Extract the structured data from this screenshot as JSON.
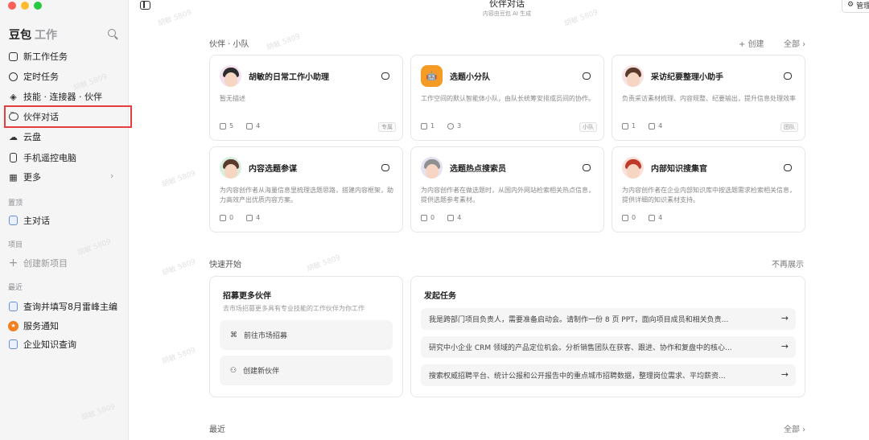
{
  "window": {
    "title": "伙伴对话",
    "subtitle": "内容由豆包 AI 生成",
    "manage_label": "管理"
  },
  "sidebar": {
    "brand": "豆包",
    "brand_sub": "工作",
    "items": [
      {
        "label": "新工作任务",
        "icon": "edit-icon"
      },
      {
        "label": "定时任务",
        "icon": "clock-icon"
      },
      {
        "label": "技能 · 连接器 · 伙伴",
        "icon": "layers-icon"
      },
      {
        "label": "伙伴对话",
        "icon": "chat-bubble-icon"
      },
      {
        "label": "云盘",
        "icon": "cloud-icon"
      },
      {
        "label": "手机遥控电脑",
        "icon": "phone-icon"
      },
      {
        "label": "更多",
        "icon": "grid-icon"
      }
    ],
    "pinned_label": "置顶",
    "pinned": [
      {
        "label": "主对话"
      }
    ],
    "projects_label": "项目",
    "create_project": "创建新项目",
    "recent_label": "最近",
    "recent": [
      {
        "label": "查询并填写8月雷峰主编"
      },
      {
        "label": "服务通知"
      },
      {
        "label": "企业知识查询"
      }
    ]
  },
  "main": {
    "partners_title": "伙伴 · 小队",
    "create_label": "+ 创建",
    "all_label": "全部 ›",
    "cards": [
      {
        "name": "胡敏的日常工作小助理",
        "desc": "暂无描述",
        "stat1": "5",
        "stat2": "4",
        "tag": "专属"
      },
      {
        "name": "选题小分队",
        "desc": "工作空间的默认智能体小队，由队长统筹安排成员间的协作。",
        "stat1": "1",
        "stat2": "3",
        "tag": "小队"
      },
      {
        "name": "采访纪要整理小助手",
        "desc": "负责采访素材梳理、内容规整、纪要输出，提升信息处理效率",
        "stat1": "1",
        "stat2": "4",
        "tag": "团队"
      },
      {
        "name": "内容选题参谋",
        "desc": "为内容创作者从海量信息里梳理选题思路，搭建内容框架，助力高效产出优质内容方案。",
        "stat1": "0",
        "stat2": "4",
        "tag": ""
      },
      {
        "name": "选题热点搜索员",
        "desc": "为内容创作者在做选题时，从国内外网站检索相关热点信息，提供选题参考素材。",
        "stat1": "0",
        "stat2": "4",
        "tag": ""
      },
      {
        "name": "内部知识搜集官",
        "desc": "为内容创作者在企业内部知识库中按选题需求检索相关信息，提供详细的知识素材支持。",
        "stat1": "0",
        "stat2": "4",
        "tag": ""
      }
    ],
    "quick_title": "快速开始",
    "dismiss_label": "不再展示",
    "recruit": {
      "title": "招募更多伙伴",
      "sub": "去市场招募更多具有专业技能的工作伙伴为你工作",
      "market": "前往市场招募",
      "create": "创建新伙伴"
    },
    "tasks": {
      "title": "发起任务",
      "items": [
        "我是跨部门项目负责人，需要准备启动会。请制作一份 8 页 PPT，面向项目成员和相关负责...",
        "研究中小企业 CRM 领域的产品定位机会。分析销售团队在获客、跟进、协作和复盘中的核心...",
        "搜索权威招聘平台、统计公报和公开报告中的重点城市招聘数据，整理岗位需求、平均薪资..."
      ]
    },
    "recent_title": "最近",
    "recent_all": "全部 ›"
  },
  "watermark": "胡敏 5809"
}
